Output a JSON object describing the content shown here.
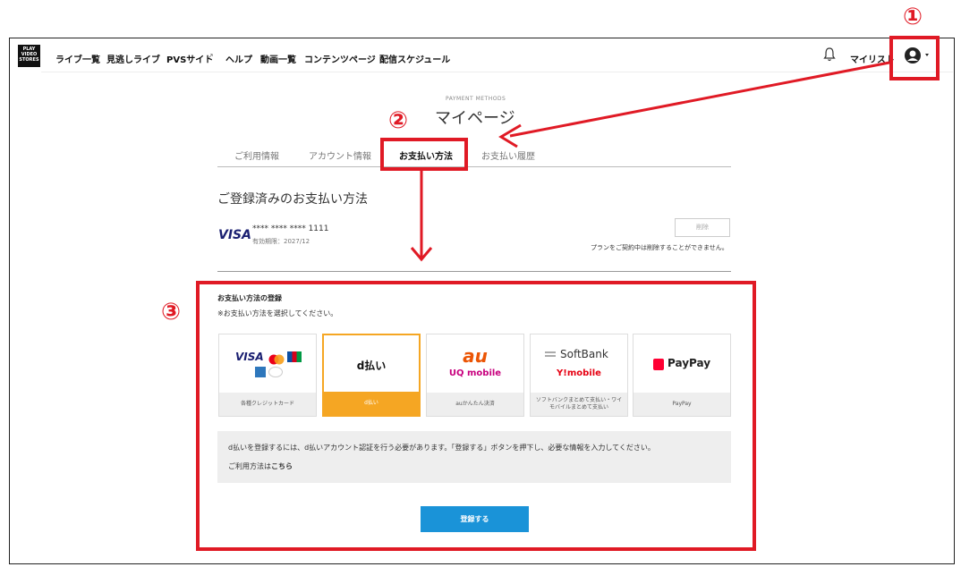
{
  "header": {
    "logo_lines": [
      "PLAY",
      "VIDEO",
      "STORES"
    ],
    "nav": [
      "ライブ一覧",
      "見逃しライブ",
      "PVSサイト",
      "ヘルプ",
      "動画一覧",
      "コンテンツページ",
      "配信スケジュール"
    ],
    "mylist": "マイリスト"
  },
  "page": {
    "eyebrow": "PAYMENT METHODS",
    "title": "マイページ",
    "tabs": [
      "ご利用情報",
      "アカウント情報",
      "お支払い方法",
      "お支払い履歴"
    ],
    "active_tab": 2
  },
  "registered": {
    "heading": "ご登録済みのお支払い方法",
    "brand": "VISA",
    "card_number": "**** **** **** 1111",
    "expiry": "有効期限：2027/12",
    "delete_label": "削除",
    "delete_note": "プランをご契約中は削除することができません。"
  },
  "register": {
    "heading": "お支払い方法の登録",
    "sub": "※お支払い方法を選択してください。",
    "methods": [
      {
        "caption": "各種クレジットカード"
      },
      {
        "logo": "d払い",
        "caption": "d払い"
      },
      {
        "logo_top": "au",
        "logo_bottom": "UQ mobile",
        "caption": "auかんたん決済"
      },
      {
        "logo_top": "SoftBank",
        "logo_bottom": "Y!mobile",
        "caption": "ソフトバンクまとめて支払い・ワイモバイルまとめて支払い"
      },
      {
        "logo": "PayPay",
        "caption": "PayPay"
      }
    ],
    "info_text": "d払いを登録するには、d払いアカウント認証を行う必要があります。「登録する」ボタンを押下し、必要な情報を入力してください。",
    "info_link_prefix": "ご利用方法は",
    "info_link": "こちら",
    "submit_label": "登録する"
  },
  "annotations": [
    "①",
    "②",
    "③"
  ],
  "colors": {
    "accent_red": "#e01a25",
    "selected_orange": "#f5a623",
    "primary_blue": "#1a93d8"
  }
}
